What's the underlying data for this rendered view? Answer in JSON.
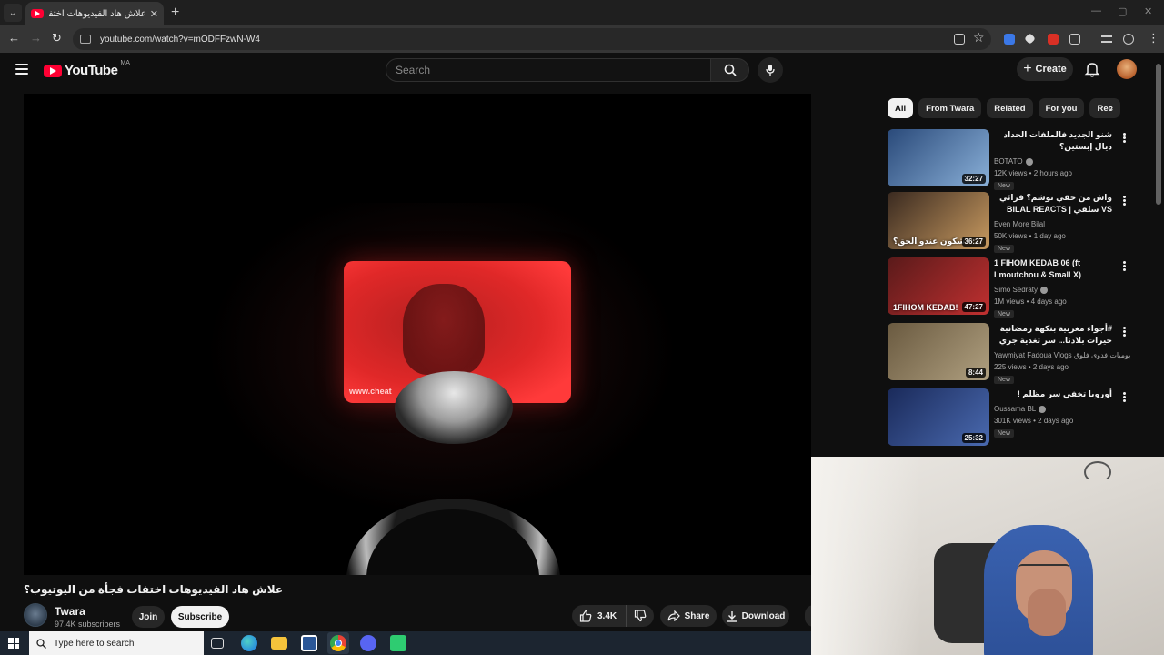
{
  "browser": {
    "tab_title": "علاش هاد الفيديوهات اختفات فجأة",
    "tab_close": "✕",
    "new_tab": "+",
    "url": "youtube.com/watch?v=mODFFzwN-W4"
  },
  "header": {
    "logo_text": "YouTube",
    "country_code": "MA",
    "search_placeholder": "Search",
    "create_label": "Create"
  },
  "video": {
    "title": "علاش هاد الفيديوهات اختفات فجأة من اليوتيوب؟",
    "watermark": "www.cheat"
  },
  "channel": {
    "name": "Twara",
    "subscribers": "97.4K subscribers",
    "join_label": "Join",
    "subscribe_label": "Subscribe"
  },
  "actions": {
    "likes": "3.4K",
    "share_label": "Share",
    "download_label": "Download"
  },
  "chips": [
    "All",
    "From Twara",
    "Related",
    "For you",
    "Rec"
  ],
  "recommendations": [
    {
      "title": "شنو الجديد فالملفات الجداد ديال إبستين؟",
      "channel": "BOTATO",
      "verified": true,
      "meta": "12K views • 2 hours ago",
      "badge": "New",
      "duration": "32:27",
      "thumb_colors": [
        "#2a4a7a",
        "#8ab0d8"
      ]
    },
    {
      "title": "واش من حقي نوشم؟ قرائي VS سلفي | BILAL REACTS",
      "channel": "Even More Bilal",
      "verified": false,
      "meta": "50K views • 1 day ago",
      "badge": "New",
      "duration": "36:27",
      "overlay_text": "شكون عندو الحق؟",
      "thumb_colors": [
        "#3a2a20",
        "#c89a60"
      ]
    },
    {
      "title": "1 FIHOM KEDAB 06 (ft Lmoutchou & Small X)",
      "channel": "Simo Sedraty",
      "verified": true,
      "meta": "1M views • 4 days ago",
      "badge": "New",
      "duration": "47:27",
      "overlay_text": "1FIHOM KEDAB!",
      "thumb_colors": [
        "#5a1a1a",
        "#c03030"
      ]
    },
    {
      "title": "#أجواء مغربية بنكهة رمضانية خيرات بلادنا... سر تغدية جري عليا نجري عليك الله يقدرنا او",
      "channel": "Yawmiyat Fadoua Vlogs يوميات فدوى فلوق",
      "verified": false,
      "meta": "225 views • 2 days ago",
      "badge": "New",
      "duration": "8:44",
      "thumb_colors": [
        "#6a5a40",
        "#b0a080"
      ]
    },
    {
      "title": "أوروبا تخفي سر مظلم !",
      "channel": "Oussama BL",
      "verified": true,
      "meta": "301K views • 2 days ago",
      "badge": "New",
      "duration": "25:32",
      "thumb_colors": [
        "#1a2a5a",
        "#4a6ab0"
      ]
    }
  ],
  "taskbar": {
    "search_placeholder": "Type here to search"
  },
  "colors": {
    "yt_red": "#ff0033",
    "background": "#0f0f0f",
    "chip_bg": "#272727"
  }
}
